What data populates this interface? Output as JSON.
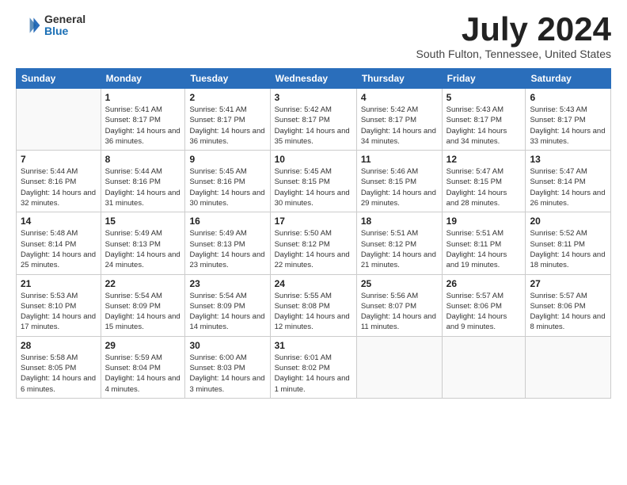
{
  "logo": {
    "general": "General",
    "blue": "Blue"
  },
  "title": "July 2024",
  "location": "South Fulton, Tennessee, United States",
  "days_of_week": [
    "Sunday",
    "Monday",
    "Tuesday",
    "Wednesday",
    "Thursday",
    "Friday",
    "Saturday"
  ],
  "weeks": [
    [
      {
        "day": "",
        "info": ""
      },
      {
        "day": "1",
        "info": "Sunrise: 5:41 AM\nSunset: 8:17 PM\nDaylight: 14 hours\nand 36 minutes."
      },
      {
        "day": "2",
        "info": "Sunrise: 5:41 AM\nSunset: 8:17 PM\nDaylight: 14 hours\nand 36 minutes."
      },
      {
        "day": "3",
        "info": "Sunrise: 5:42 AM\nSunset: 8:17 PM\nDaylight: 14 hours\nand 35 minutes."
      },
      {
        "day": "4",
        "info": "Sunrise: 5:42 AM\nSunset: 8:17 PM\nDaylight: 14 hours\nand 34 minutes."
      },
      {
        "day": "5",
        "info": "Sunrise: 5:43 AM\nSunset: 8:17 PM\nDaylight: 14 hours\nand 34 minutes."
      },
      {
        "day": "6",
        "info": "Sunrise: 5:43 AM\nSunset: 8:17 PM\nDaylight: 14 hours\nand 33 minutes."
      }
    ],
    [
      {
        "day": "7",
        "info": "Sunrise: 5:44 AM\nSunset: 8:16 PM\nDaylight: 14 hours\nand 32 minutes."
      },
      {
        "day": "8",
        "info": "Sunrise: 5:44 AM\nSunset: 8:16 PM\nDaylight: 14 hours\nand 31 minutes."
      },
      {
        "day": "9",
        "info": "Sunrise: 5:45 AM\nSunset: 8:16 PM\nDaylight: 14 hours\nand 30 minutes."
      },
      {
        "day": "10",
        "info": "Sunrise: 5:45 AM\nSunset: 8:15 PM\nDaylight: 14 hours\nand 30 minutes."
      },
      {
        "day": "11",
        "info": "Sunrise: 5:46 AM\nSunset: 8:15 PM\nDaylight: 14 hours\nand 29 minutes."
      },
      {
        "day": "12",
        "info": "Sunrise: 5:47 AM\nSunset: 8:15 PM\nDaylight: 14 hours\nand 28 minutes."
      },
      {
        "day": "13",
        "info": "Sunrise: 5:47 AM\nSunset: 8:14 PM\nDaylight: 14 hours\nand 26 minutes."
      }
    ],
    [
      {
        "day": "14",
        "info": "Sunrise: 5:48 AM\nSunset: 8:14 PM\nDaylight: 14 hours\nand 25 minutes."
      },
      {
        "day": "15",
        "info": "Sunrise: 5:49 AM\nSunset: 8:13 PM\nDaylight: 14 hours\nand 24 minutes."
      },
      {
        "day": "16",
        "info": "Sunrise: 5:49 AM\nSunset: 8:13 PM\nDaylight: 14 hours\nand 23 minutes."
      },
      {
        "day": "17",
        "info": "Sunrise: 5:50 AM\nSunset: 8:12 PM\nDaylight: 14 hours\nand 22 minutes."
      },
      {
        "day": "18",
        "info": "Sunrise: 5:51 AM\nSunset: 8:12 PM\nDaylight: 14 hours\nand 21 minutes."
      },
      {
        "day": "19",
        "info": "Sunrise: 5:51 AM\nSunset: 8:11 PM\nDaylight: 14 hours\nand 19 minutes."
      },
      {
        "day": "20",
        "info": "Sunrise: 5:52 AM\nSunset: 8:11 PM\nDaylight: 14 hours\nand 18 minutes."
      }
    ],
    [
      {
        "day": "21",
        "info": "Sunrise: 5:53 AM\nSunset: 8:10 PM\nDaylight: 14 hours\nand 17 minutes."
      },
      {
        "day": "22",
        "info": "Sunrise: 5:54 AM\nSunset: 8:09 PM\nDaylight: 14 hours\nand 15 minutes."
      },
      {
        "day": "23",
        "info": "Sunrise: 5:54 AM\nSunset: 8:09 PM\nDaylight: 14 hours\nand 14 minutes."
      },
      {
        "day": "24",
        "info": "Sunrise: 5:55 AM\nSunset: 8:08 PM\nDaylight: 14 hours\nand 12 minutes."
      },
      {
        "day": "25",
        "info": "Sunrise: 5:56 AM\nSunset: 8:07 PM\nDaylight: 14 hours\nand 11 minutes."
      },
      {
        "day": "26",
        "info": "Sunrise: 5:57 AM\nSunset: 8:06 PM\nDaylight: 14 hours\nand 9 minutes."
      },
      {
        "day": "27",
        "info": "Sunrise: 5:57 AM\nSunset: 8:06 PM\nDaylight: 14 hours\nand 8 minutes."
      }
    ],
    [
      {
        "day": "28",
        "info": "Sunrise: 5:58 AM\nSunset: 8:05 PM\nDaylight: 14 hours\nand 6 minutes."
      },
      {
        "day": "29",
        "info": "Sunrise: 5:59 AM\nSunset: 8:04 PM\nDaylight: 14 hours\nand 4 minutes."
      },
      {
        "day": "30",
        "info": "Sunrise: 6:00 AM\nSunset: 8:03 PM\nDaylight: 14 hours\nand 3 minutes."
      },
      {
        "day": "31",
        "info": "Sunrise: 6:01 AM\nSunset: 8:02 PM\nDaylight: 14 hours\nand 1 minute."
      },
      {
        "day": "",
        "info": ""
      },
      {
        "day": "",
        "info": ""
      },
      {
        "day": "",
        "info": ""
      }
    ]
  ]
}
